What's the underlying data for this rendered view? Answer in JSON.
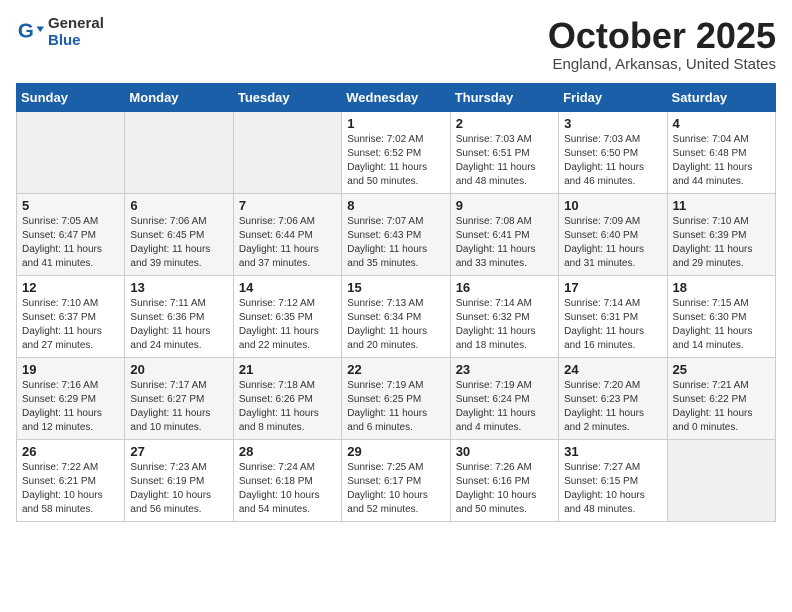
{
  "header": {
    "logo_general": "General",
    "logo_blue": "Blue",
    "month": "October 2025",
    "location": "England, Arkansas, United States"
  },
  "days_of_week": [
    "Sunday",
    "Monday",
    "Tuesday",
    "Wednesday",
    "Thursday",
    "Friday",
    "Saturday"
  ],
  "weeks": [
    [
      {
        "day": "",
        "info": ""
      },
      {
        "day": "",
        "info": ""
      },
      {
        "day": "",
        "info": ""
      },
      {
        "day": "1",
        "info": "Sunrise: 7:02 AM\nSunset: 6:52 PM\nDaylight: 11 hours\nand 50 minutes."
      },
      {
        "day": "2",
        "info": "Sunrise: 7:03 AM\nSunset: 6:51 PM\nDaylight: 11 hours\nand 48 minutes."
      },
      {
        "day": "3",
        "info": "Sunrise: 7:03 AM\nSunset: 6:50 PM\nDaylight: 11 hours\nand 46 minutes."
      },
      {
        "day": "4",
        "info": "Sunrise: 7:04 AM\nSunset: 6:48 PM\nDaylight: 11 hours\nand 44 minutes."
      }
    ],
    [
      {
        "day": "5",
        "info": "Sunrise: 7:05 AM\nSunset: 6:47 PM\nDaylight: 11 hours\nand 41 minutes."
      },
      {
        "day": "6",
        "info": "Sunrise: 7:06 AM\nSunset: 6:45 PM\nDaylight: 11 hours\nand 39 minutes."
      },
      {
        "day": "7",
        "info": "Sunrise: 7:06 AM\nSunset: 6:44 PM\nDaylight: 11 hours\nand 37 minutes."
      },
      {
        "day": "8",
        "info": "Sunrise: 7:07 AM\nSunset: 6:43 PM\nDaylight: 11 hours\nand 35 minutes."
      },
      {
        "day": "9",
        "info": "Sunrise: 7:08 AM\nSunset: 6:41 PM\nDaylight: 11 hours\nand 33 minutes."
      },
      {
        "day": "10",
        "info": "Sunrise: 7:09 AM\nSunset: 6:40 PM\nDaylight: 11 hours\nand 31 minutes."
      },
      {
        "day": "11",
        "info": "Sunrise: 7:10 AM\nSunset: 6:39 PM\nDaylight: 11 hours\nand 29 minutes."
      }
    ],
    [
      {
        "day": "12",
        "info": "Sunrise: 7:10 AM\nSunset: 6:37 PM\nDaylight: 11 hours\nand 27 minutes."
      },
      {
        "day": "13",
        "info": "Sunrise: 7:11 AM\nSunset: 6:36 PM\nDaylight: 11 hours\nand 24 minutes."
      },
      {
        "day": "14",
        "info": "Sunrise: 7:12 AM\nSunset: 6:35 PM\nDaylight: 11 hours\nand 22 minutes."
      },
      {
        "day": "15",
        "info": "Sunrise: 7:13 AM\nSunset: 6:34 PM\nDaylight: 11 hours\nand 20 minutes."
      },
      {
        "day": "16",
        "info": "Sunrise: 7:14 AM\nSunset: 6:32 PM\nDaylight: 11 hours\nand 18 minutes."
      },
      {
        "day": "17",
        "info": "Sunrise: 7:14 AM\nSunset: 6:31 PM\nDaylight: 11 hours\nand 16 minutes."
      },
      {
        "day": "18",
        "info": "Sunrise: 7:15 AM\nSunset: 6:30 PM\nDaylight: 11 hours\nand 14 minutes."
      }
    ],
    [
      {
        "day": "19",
        "info": "Sunrise: 7:16 AM\nSunset: 6:29 PM\nDaylight: 11 hours\nand 12 minutes."
      },
      {
        "day": "20",
        "info": "Sunrise: 7:17 AM\nSunset: 6:27 PM\nDaylight: 11 hours\nand 10 minutes."
      },
      {
        "day": "21",
        "info": "Sunrise: 7:18 AM\nSunset: 6:26 PM\nDaylight: 11 hours\nand 8 minutes."
      },
      {
        "day": "22",
        "info": "Sunrise: 7:19 AM\nSunset: 6:25 PM\nDaylight: 11 hours\nand 6 minutes."
      },
      {
        "day": "23",
        "info": "Sunrise: 7:19 AM\nSunset: 6:24 PM\nDaylight: 11 hours\nand 4 minutes."
      },
      {
        "day": "24",
        "info": "Sunrise: 7:20 AM\nSunset: 6:23 PM\nDaylight: 11 hours\nand 2 minutes."
      },
      {
        "day": "25",
        "info": "Sunrise: 7:21 AM\nSunset: 6:22 PM\nDaylight: 11 hours\nand 0 minutes."
      }
    ],
    [
      {
        "day": "26",
        "info": "Sunrise: 7:22 AM\nSunset: 6:21 PM\nDaylight: 10 hours\nand 58 minutes."
      },
      {
        "day": "27",
        "info": "Sunrise: 7:23 AM\nSunset: 6:19 PM\nDaylight: 10 hours\nand 56 minutes."
      },
      {
        "day": "28",
        "info": "Sunrise: 7:24 AM\nSunset: 6:18 PM\nDaylight: 10 hours\nand 54 minutes."
      },
      {
        "day": "29",
        "info": "Sunrise: 7:25 AM\nSunset: 6:17 PM\nDaylight: 10 hours\nand 52 minutes."
      },
      {
        "day": "30",
        "info": "Sunrise: 7:26 AM\nSunset: 6:16 PM\nDaylight: 10 hours\nand 50 minutes."
      },
      {
        "day": "31",
        "info": "Sunrise: 7:27 AM\nSunset: 6:15 PM\nDaylight: 10 hours\nand 48 minutes."
      },
      {
        "day": "",
        "info": ""
      }
    ]
  ]
}
